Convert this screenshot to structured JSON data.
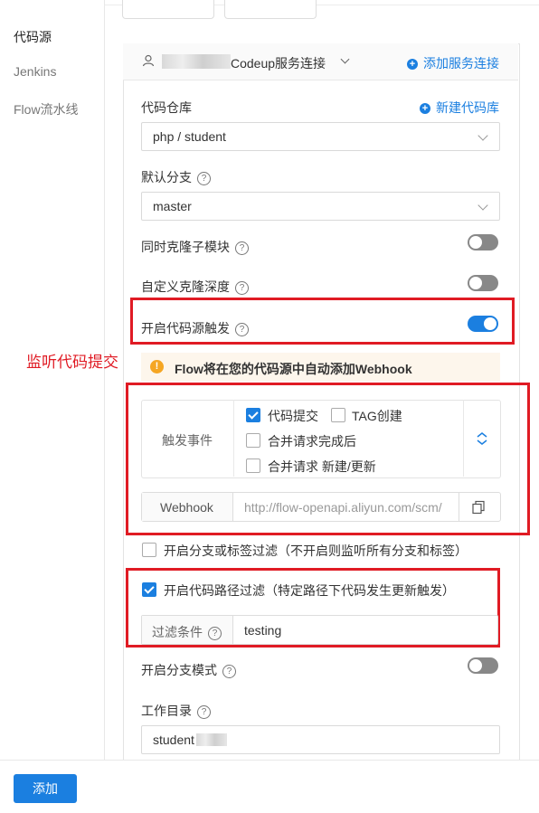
{
  "sidebar": {
    "items": [
      {
        "label": "代码源"
      },
      {
        "label": "Jenkins"
      },
      {
        "label": "Flow流水线"
      }
    ]
  },
  "service": {
    "connection_label": "Codeup服务连接",
    "add_connection": "添加服务连接"
  },
  "repo": {
    "label": "代码仓库",
    "new_repo": "新建代码库",
    "value": "php / student"
  },
  "branch": {
    "label": "默认分支",
    "value": "master"
  },
  "submodule": {
    "label": "同时克隆子模块"
  },
  "clone_depth": {
    "label": "自定义克隆深度"
  },
  "trigger": {
    "label": "开启代码源触发",
    "annotation": "监听代码提交"
  },
  "notice": {
    "text": "Flow将在您的代码源中自动添加Webhook"
  },
  "events": {
    "label": "触发事件",
    "options": [
      {
        "label": "代码提交"
      },
      {
        "label": "TAG创建"
      },
      {
        "label": "合并请求完成后"
      },
      {
        "label": "合并请求 新建/更新"
      }
    ]
  },
  "webhook": {
    "label": "Webhook",
    "url": "http://flow-openapi.aliyun.com/scm/"
  },
  "branch_filter": {
    "label": "开启分支或标签过滤（不开启则监听所有分支和标签）"
  },
  "path_filter": {
    "label": "开启代码路径过滤（特定路径下代码发生更新触发）",
    "condition_label": "过滤条件",
    "condition_value": "testing"
  },
  "branch_mode": {
    "label": "开启分支模式"
  },
  "workdir": {
    "label": "工作目录",
    "value": "student"
  },
  "footer": {
    "add_button": "添加"
  },
  "colors": {
    "accent": "#1b7fe0",
    "annotation_red": "#e01b24"
  }
}
